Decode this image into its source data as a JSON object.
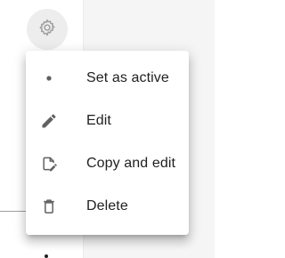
{
  "toolbar": {
    "settings_icon": "gear-icon"
  },
  "menu": {
    "items": [
      {
        "label": "Set as active",
        "icon": "dot-icon"
      },
      {
        "label": "Edit",
        "icon": "pencil-icon"
      },
      {
        "label": "Copy and edit",
        "icon": "copy-edit-icon"
      },
      {
        "label": "Delete",
        "icon": "trash-icon"
      }
    ]
  },
  "colors": {
    "icon": "#616161",
    "text": "#212121",
    "menu_bg": "#ffffff",
    "button_bg": "#ededed"
  }
}
